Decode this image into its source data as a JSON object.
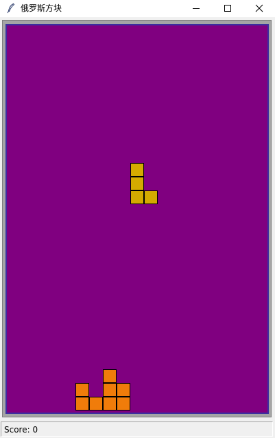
{
  "window": {
    "title": "俄罗斯方块",
    "icon": "feather-icon"
  },
  "board": {
    "background": "#800080",
    "columns": 19,
    "rows": 28,
    "falling_piece": {
      "shape": "L",
      "color": "#d4aa00",
      "cells": [
        [
          9,
          10
        ],
        [
          9,
          11
        ],
        [
          9,
          12
        ],
        [
          10,
          12
        ]
      ]
    },
    "settled_blocks": {
      "color": "#f07c0a",
      "cells": [
        [
          5,
          26
        ],
        [
          7,
          25
        ],
        [
          7,
          26
        ],
        [
          8,
          26
        ],
        [
          5,
          27
        ],
        [
          6,
          27
        ],
        [
          7,
          27
        ],
        [
          8,
          27
        ]
      ]
    }
  },
  "status": {
    "score_text": "Score: 0"
  }
}
